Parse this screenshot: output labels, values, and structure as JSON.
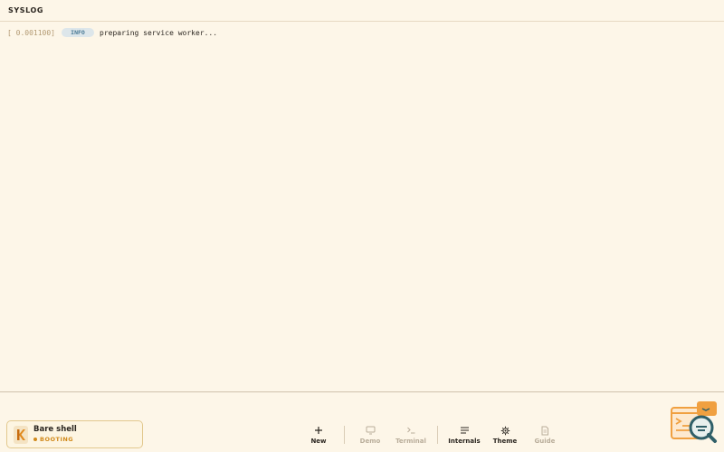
{
  "header": {
    "title": "SYSLOG"
  },
  "log": {
    "entries": [
      {
        "timestamp": "[ 0.001100]",
        "level": "INFO",
        "message": "preparing service worker..."
      }
    ]
  },
  "session": {
    "name": "Bare shell",
    "status": "BOOTING"
  },
  "toolbar": {
    "new": {
      "label": "New",
      "icon": "plus-icon"
    },
    "demo": {
      "label": "Demo",
      "icon": "monitor-icon"
    },
    "terminal": {
      "label": "Terminal",
      "icon": "terminal-icon"
    },
    "internals": {
      "label": "Internals",
      "icon": "list-icon"
    },
    "theme": {
      "label": "Theme",
      "icon": "gear-icon"
    },
    "guide": {
      "label": "Guide",
      "icon": "document-icon"
    }
  },
  "colors": {
    "background": "#fdf6e8",
    "accent": "#d18a1c",
    "info_badge": "#dde6ea",
    "mascot_orange": "#f0a040",
    "mascot_teal": "#2f5f68"
  }
}
